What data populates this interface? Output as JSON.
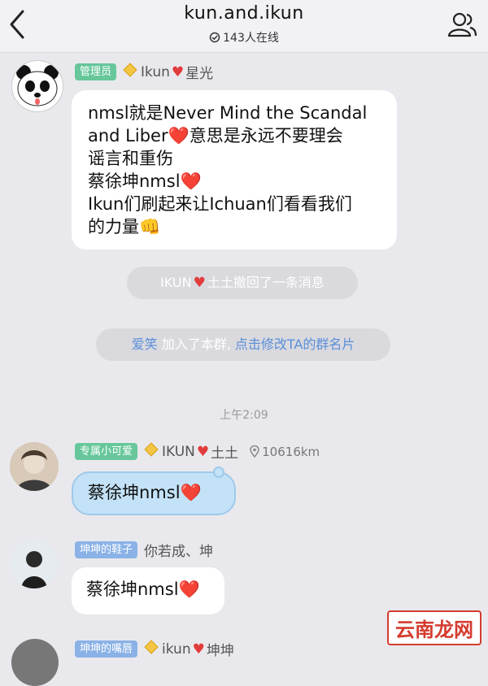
{
  "header": {
    "title": "kun.and.ikun",
    "online_count": "143人在线",
    "back_icon": "chevron-left-icon",
    "group_icon": "group-members-icon"
  },
  "messages": [
    {
      "tag": "管理员",
      "name_prefix": "Ikun",
      "name_suffix": "星光",
      "lines": [
        "nmsl就是Never Mind the Scandal",
        "and Liber❤️意思是永远不要理会",
        "谣言和重伤",
        "蔡徐坤nmsl❤️",
        "Ikun们刷起来让Ichuan们看看我们",
        "的力量👊"
      ]
    },
    {
      "tag": "专属小可爱",
      "name_prefix": "IKUN",
      "name_suffix": "土土",
      "distance": "10616km",
      "text": "蔡徐坤nmsl❤️"
    },
    {
      "tag": "坤坤的鞋子",
      "name": "你若成、坤",
      "text": "蔡徐坤nmsl❤️"
    },
    {
      "tag": "坤坤的嘴唇",
      "name_prefix": "ikun",
      "name_suffix": "坤坤"
    }
  ],
  "system": {
    "recall_name": "IKUN",
    "recall_suffix": "土土撤回了一条消息",
    "join_name": "爱笑",
    "join_mid": "加入了本群,",
    "join_link": "点击修改TA的群名片"
  },
  "timestamp": "上午2:09",
  "watermark": "云南龙网",
  "colors": {
    "admin_tag": "#67c79b",
    "member_tag": "#8ab2e6",
    "heart": "#e23b3b",
    "link": "#5b8fd9"
  }
}
